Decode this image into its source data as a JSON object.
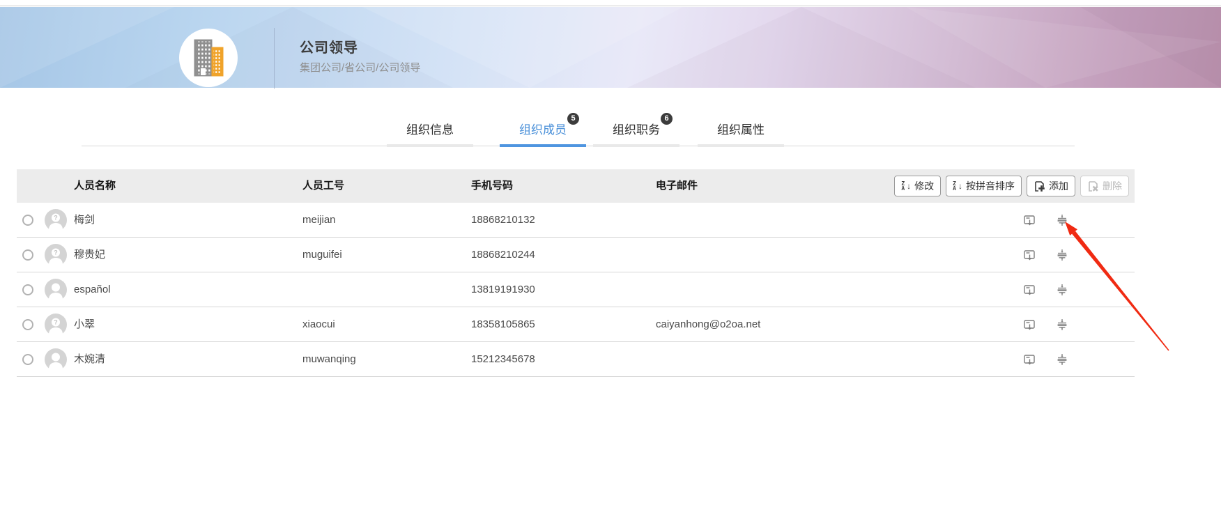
{
  "banner": {
    "title": "公司领导",
    "breadcrumb": "集团公司/省公司/公司领导",
    "icon": "building-icon"
  },
  "tabs": [
    {
      "label": "组织信息",
      "badge": "",
      "active": false
    },
    {
      "label": "组织成员",
      "badge": "5",
      "active": true
    },
    {
      "label": "组织职务",
      "badge": "6",
      "active": false
    },
    {
      "label": "组织属性",
      "badge": "",
      "active": false
    }
  ],
  "toolbar": {
    "modify_label": "修改",
    "sort_pinyin_label": "按拼音排序",
    "add_label": "添加",
    "delete_label": "删除"
  },
  "table": {
    "columns": {
      "name": "人员名称",
      "employee_id": "人员工号",
      "mobile": "手机号码",
      "email": "电子邮件"
    },
    "rows": [
      {
        "name": "梅剑",
        "employee_id": "meijian",
        "mobile": "18868210132",
        "email": "",
        "avatar_question": true
      },
      {
        "name": "穆贵妃",
        "employee_id": "muguifei",
        "mobile": "18868210244",
        "email": "",
        "avatar_question": true
      },
      {
        "name": "español",
        "employee_id": "",
        "mobile": "13819191930",
        "email": "",
        "avatar_question": false
      },
      {
        "name": "小翠",
        "employee_id": "xiaocui",
        "mobile": "18358105865",
        "email": "caiyanhong@o2oa.net",
        "avatar_question": true
      },
      {
        "name": "木婉清",
        "employee_id": "muwanqing",
        "mobile": "15212345678",
        "email": "",
        "avatar_question": false
      }
    ]
  },
  "colors": {
    "tab_active": "#4a90d9",
    "tab_underline_active": "#4f95e0",
    "badge_bg": "#3c3c3c",
    "table_header_bg": "#ececec",
    "annotation_red": "#f02a12",
    "banner_left": "#a5c6e6",
    "banner_right": "#ba91ad",
    "building_gray": "#8f8f8f",
    "building_orange": "#f0a32a"
  },
  "annotation": {
    "shape": "red-arrow",
    "points_at": "sort-order-icon of first row"
  }
}
